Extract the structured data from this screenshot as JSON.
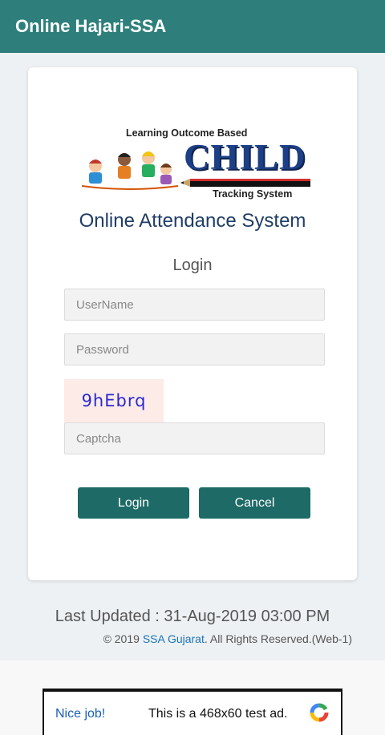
{
  "appbar": {
    "title": "Online Hajari-SSA"
  },
  "logo": {
    "top_text": "Learning Outcome Based",
    "main_text": "CHILD",
    "bottom_text": "Tracking System"
  },
  "form": {
    "system_title": "Online Attendance System",
    "login_title": "Login",
    "username_placeholder": "UserName",
    "password_placeholder": "Password",
    "captcha_code": "9hEbrq",
    "captcha_placeholder": "Captcha",
    "login_label": "Login",
    "cancel_label": "Cancel"
  },
  "footer": {
    "last_updated": "Last Updated : 31-Aug-2019 03:00 PM",
    "copyright_prefix": "© 2019 ",
    "copyright_link": "SSA Gujarat",
    "copyright_suffix": ". All Rights Reserved.(Web-1)"
  },
  "ad": {
    "nice_text": "Nice job!",
    "ad_text": "This is a 468x60 test ad."
  },
  "colors": {
    "appbar": "#2e7f7b",
    "button": "#1d6a66",
    "title": "#1f3d66",
    "captcha_bg": "#fcebe7"
  }
}
